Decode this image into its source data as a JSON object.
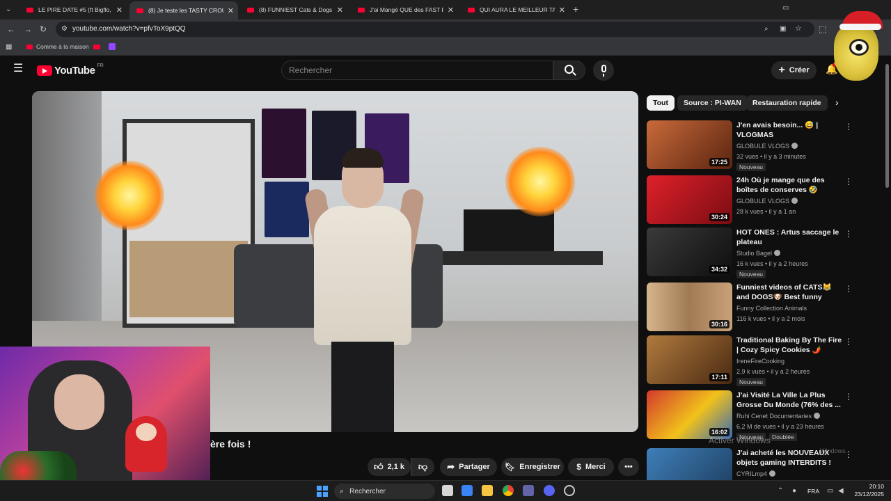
{
  "browser": {
    "tabs": [
      {
        "title": "LE PIRE DATE #5 (ft Bigflo, Anyme",
        "active": false
      },
      {
        "title": "(8) Je teste les TASTY CROUSTY",
        "active": true
      },
      {
        "title": "(8) FUNNIEST Cats & Dogs Com",
        "active": false
      },
      {
        "title": "J'ai Mangé QUE des FAST FOOD",
        "active": false
      },
      {
        "title": "QUI AURA LE MEILLEUR TALENT",
        "active": false
      }
    ],
    "new_tab": "+",
    "url": "youtube.com/watch?v=pfvToX9ptQQ",
    "bookmarks": [
      {
        "label": "Comme à la maison"
      }
    ]
  },
  "youtube": {
    "logo": "YouTube",
    "country": "FR",
    "search_placeholder": "Rechercher",
    "create_label": "Créer",
    "notification_count": "9+"
  },
  "video": {
    "title_partial": "ère fois !",
    "actions": {
      "likes": "2,1 k",
      "share": "Partager",
      "save": "Enregistrer",
      "thanks": "Merci"
    }
  },
  "chips": [
    "Tout",
    "Source : PI-WAN",
    "Restauration rapide"
  ],
  "recommendations": [
    {
      "title": "J'en avais besoin... 😅 | VLOGMAS",
      "channel": "GLOBULE VLOGS",
      "verified": true,
      "meta": "32 vues • il y a 3 minutes",
      "duration": "17:25",
      "badge": "Nouveau",
      "thumb_bg": "#7a3a22"
    },
    {
      "title": "24h Où je mange que des boîtes de conserves 🤣",
      "channel": "GLOBULE VLOGS",
      "verified": true,
      "meta": "28 k vues • il y a 1 an",
      "duration": "30:24",
      "badge": "",
      "thumb_bg": "#b3141c"
    },
    {
      "title": "HOT ONES : Artus saccage le plateau",
      "channel": "Studio Bagel",
      "verified": true,
      "meta": "16 k vues • il y a 2 heures",
      "duration": "34:32",
      "badge": "Nouveau",
      "thumb_bg": "#1a1a1a"
    },
    {
      "title": "Funniest videos of CATS😹 and DOGS🐶 Best funny videos of ...",
      "channel": "Funny Collection Animals",
      "verified": false,
      "meta": "116 k vues • il y a 2 mois",
      "duration": "30:16",
      "badge": "",
      "thumb_bg": "#c7a98a"
    },
    {
      "title": "Traditional Baking By The Fire | Cozy Spicy Cookies 🌶️",
      "channel": "IreneFireCooking",
      "verified": false,
      "meta": "2,9 k vues • il y a 2 heures",
      "duration": "17:11",
      "badge": "Nouveau",
      "thumb_bg": "#8a5a2e"
    },
    {
      "title": "J'ai Visité La Ville La Plus Grosse Du Monde (76% des ...",
      "channel": "Ruhi Cenet Documentaries",
      "verified": true,
      "meta": "6,2 M de vues • il y a 23 heures",
      "duration": "16:02",
      "badge": "Nouveau",
      "badge2": "Doublée",
      "thumb_bg": "#c9302c"
    },
    {
      "title": "J'ai acheté les NOUVEAUX objets gaming INTERDITS !",
      "channel": "CYRILmp4",
      "verified": true,
      "meta": "",
      "duration": "",
      "badge": "",
      "thumb_bg": "#2e5d8a"
    }
  ],
  "watermark": {
    "line1": "Activer Windows",
    "line2": "Windows."
  },
  "taskbar": {
    "search_label": "Rechercher",
    "language": "FRA",
    "time": "20:10",
    "date": "23/12/2025"
  },
  "colors": {
    "youtube_red": "#ff0033",
    "background": "#0f0f0f",
    "chip_bg": "#272727"
  },
  "icons": [
    "menu-icon",
    "search-icon",
    "mic-icon",
    "bell-icon",
    "plus-icon",
    "like-icon",
    "dislike-icon",
    "share-icon",
    "save-icon",
    "thanks-icon",
    "more-icon",
    "chevron-right-icon"
  ]
}
